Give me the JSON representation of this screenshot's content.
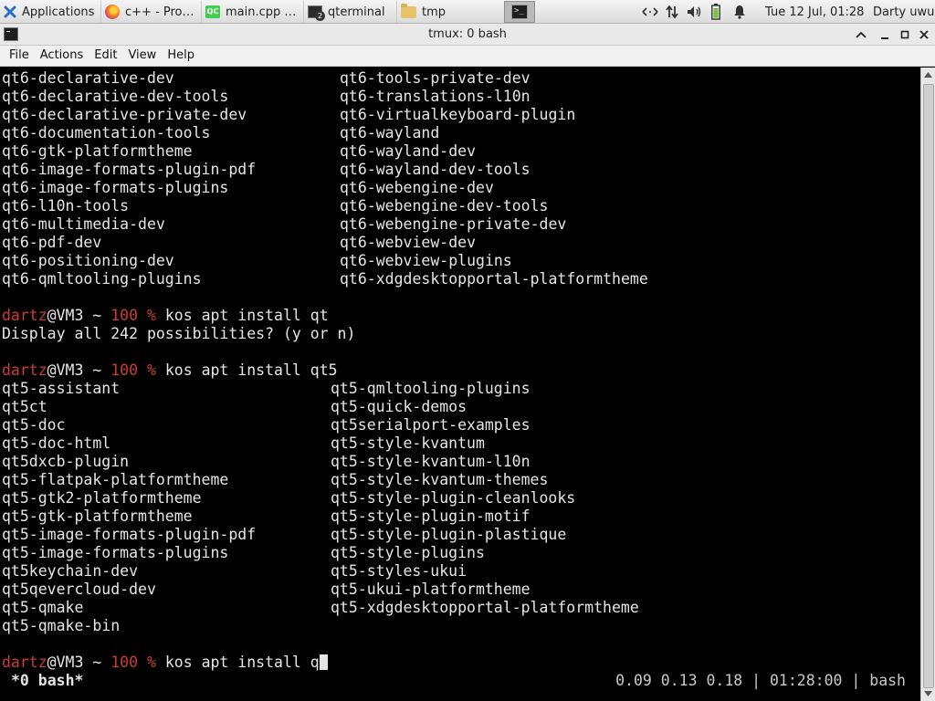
{
  "panel": {
    "apps_label": "Applications",
    "tasks": [
      {
        "label": "c++ - Pro…",
        "icon": "firefox-icon"
      },
      {
        "label": "main.cpp …",
        "icon": "qtcreator-icon"
      },
      {
        "label": "qterminal",
        "icon": "terminal-icon",
        "badge": "2"
      },
      {
        "label": "tmp",
        "icon": "folder-icon"
      }
    ],
    "clock": "Tue 12 Jul, 01:28",
    "user": "Darty uwu"
  },
  "window": {
    "title": "tmux: 0 bash"
  },
  "menu": [
    "File",
    "Actions",
    "Edit",
    "View",
    "Help"
  ],
  "terminal": {
    "qt6_col1": [
      "qt6-declarative-dev",
      "qt6-declarative-dev-tools",
      "qt6-declarative-private-dev",
      "qt6-documentation-tools",
      "qt6-gtk-platformtheme",
      "qt6-image-formats-plugin-pdf",
      "qt6-image-formats-plugins",
      "qt6-l10n-tools",
      "qt6-multimedia-dev",
      "qt6-pdf-dev",
      "qt6-positioning-dev",
      "qt6-qmltooling-plugins"
    ],
    "qt6_col2": [
      "qt6-tools-private-dev",
      "qt6-translations-l10n",
      "qt6-virtualkeyboard-plugin",
      "qt6-wayland",
      "qt6-wayland-dev",
      "qt6-wayland-dev-tools",
      "qt6-webengine-dev",
      "qt6-webengine-dev-tools",
      "qt6-webengine-private-dev",
      "qt6-webview-dev",
      "qt6-webview-plugins",
      "qt6-xdgdesktopportal-platformtheme"
    ],
    "prompt": {
      "user": "dartz",
      "host": "@VM3 ~ ",
      "pct": "100 %",
      "sep": " "
    },
    "cmd1": "kos apt install qt",
    "msg1": "Display all 242 possibilities? (y or n)",
    "cmd2": "kos apt install qt5",
    "qt5_col1": [
      "qt5-assistant",
      "qt5ct",
      "qt5-doc",
      "qt5-doc-html",
      "qt5dxcb-plugin",
      "qt5-flatpak-platformtheme",
      "qt5-gtk2-platformtheme",
      "qt5-gtk-platformtheme",
      "qt5-image-formats-plugin-pdf",
      "qt5-image-formats-plugins",
      "qt5keychain-dev",
      "qt5qevercloud-dev",
      "qt5-qmake",
      "qt5-qmake-bin"
    ],
    "qt5_col2": [
      "qt5-qmltooling-plugins",
      "qt5-quick-demos",
      "qt5serialport-examples",
      "qt5-style-kvantum",
      "qt5-style-kvantum-l10n",
      "qt5-style-kvantum-themes",
      "qt5-style-plugin-cleanlooks",
      "qt5-style-plugin-motif",
      "qt5-style-plugin-plastique",
      "qt5-style-plugins",
      "qt5-styles-ukui",
      "qt5-ukui-platformtheme",
      "qt5-xdgdesktopportal-platformtheme"
    ],
    "cmd3": "kos apt install q",
    "status_left": "*0 bash*",
    "status_right": "0.09 0.13 0.18 | 01:28:00 | bash"
  }
}
